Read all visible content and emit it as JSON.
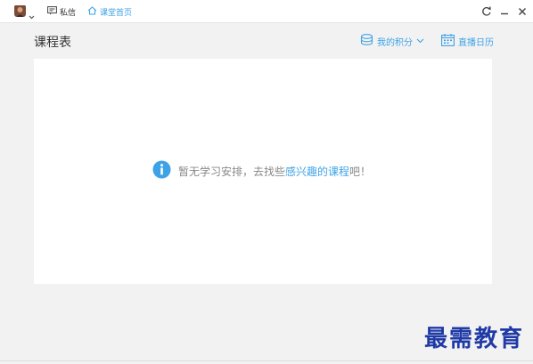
{
  "topbar": {
    "avatar_icon": "user-avatar",
    "message_label": "私信",
    "home_label": "课堂首页",
    "controls": [
      "refresh-icon",
      "minimize-icon",
      "close-icon"
    ]
  },
  "page": {
    "title": "课程表",
    "points_label": "我的积分",
    "calendar_label": "直播日历"
  },
  "empty_state": {
    "text_before": "暂无学习安排，去找些",
    "link_text": "感兴趣的课程",
    "text_after": "吧！"
  },
  "watermark": "最需教育",
  "colors": {
    "accent": "#3ea2e6",
    "background": "#f2f2f2",
    "card": "#ffffff",
    "muted_text": "#888888"
  }
}
